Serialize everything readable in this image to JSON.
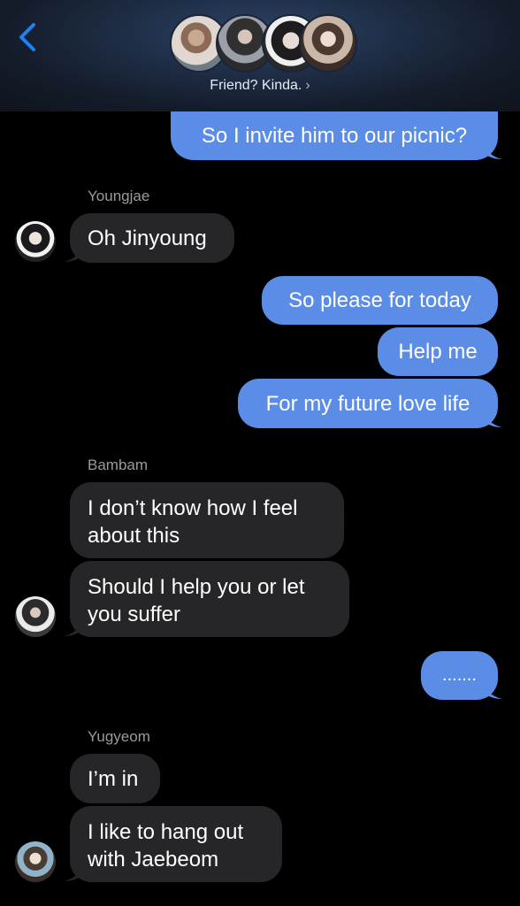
{
  "header": {
    "group_name": "Friend? Kinda.",
    "chevron": "›",
    "back_icon": "chevron-left-icon",
    "accent": "#1e82f0"
  },
  "messages": [
    {
      "type": "outgoing",
      "text": "So I invite him to our picnic?"
    },
    {
      "type": "sender",
      "text": "Youngjae"
    },
    {
      "type": "incoming",
      "text": "Oh Jinyoung"
    },
    {
      "type": "outgoing",
      "text": "So please for today"
    },
    {
      "type": "outgoing",
      "text": "Help me"
    },
    {
      "type": "outgoing",
      "text": "For my future love life"
    },
    {
      "type": "sender",
      "text": "Bambam"
    },
    {
      "type": "incoming",
      "lines": [
        "I don’t know how I feel",
        "about this"
      ]
    },
    {
      "type": "incoming",
      "lines": [
        "Should I help you or let",
        "you suffer"
      ]
    },
    {
      "type": "outgoing",
      "text": "......."
    },
    {
      "type": "sender",
      "text": "Yugyeom"
    },
    {
      "type": "incoming",
      "text": "I’m in"
    },
    {
      "type": "incoming",
      "lines": [
        "I like to hang out",
        "with Jaebeom"
      ]
    }
  ],
  "colors": {
    "outgoing_bubble": "#5b8ce6",
    "incoming_bubble": "#262628",
    "sender_label": "#9a9aa0",
    "background": "#000000"
  }
}
